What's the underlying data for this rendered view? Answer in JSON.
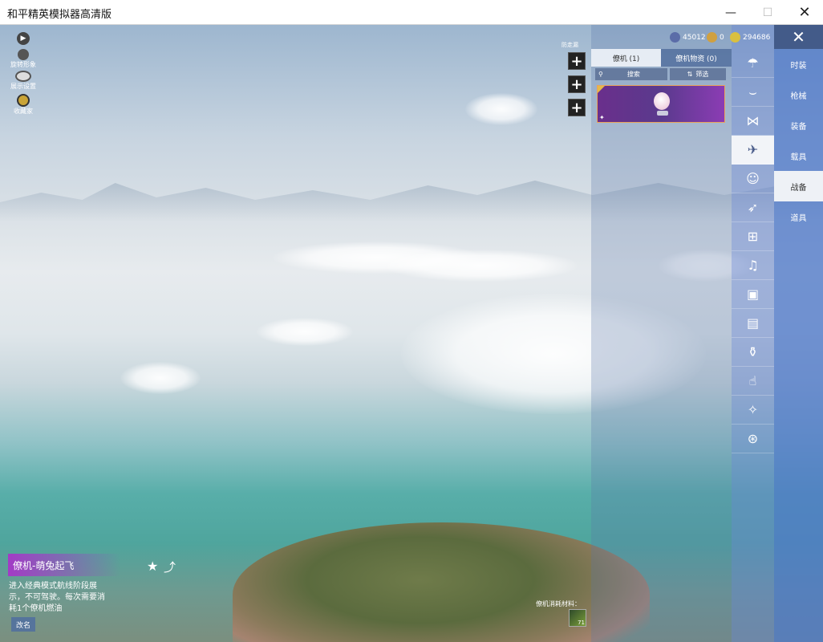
{
  "window": {
    "title": "和平精英模拟器高清版",
    "min_glyph": "—",
    "max_glyph": "☐",
    "close_glyph": "✕"
  },
  "left_tools": [
    {
      "label": "",
      "icon": "play-icon"
    },
    {
      "label": "旋转形象",
      "icon": "person-icon"
    },
    {
      "label": "展示设置",
      "icon": "eye-icon"
    },
    {
      "label": "收藏家",
      "icon": "collector-badge-icon"
    }
  ],
  "hud": {
    "top_small_text": "防走漏",
    "currency": [
      {
        "icon": "gem-icon",
        "value": "45012",
        "color": "#5b6ca8"
      },
      {
        "icon": "medal-icon",
        "value": "0",
        "color": "#d0a040"
      },
      {
        "icon": "coupon-icon",
        "value": "294686",
        "color": "#d9c040"
      }
    ],
    "close_glyph": "✕"
  },
  "plus_buttons": [
    "+",
    "+",
    "+"
  ],
  "panel": {
    "tabs": [
      {
        "label": "僚机 (1)",
        "active": true
      },
      {
        "label": "僚机物资 (0)",
        "active": false
      }
    ],
    "search_label": "搜索",
    "filter_label": "筛选",
    "card": {
      "name": "萌兔起飞",
      "corner_glyph": "✦"
    }
  },
  "icon_column": [
    {
      "icon": "parachute-icon",
      "active": false
    },
    {
      "icon": "glider-icon",
      "active": false
    },
    {
      "icon": "drone-icon",
      "active": false
    },
    {
      "icon": "plane-icon",
      "active": true
    },
    {
      "icon": "emote-icon",
      "active": false
    },
    {
      "icon": "jet-icon",
      "active": false
    },
    {
      "icon": "robot-icon",
      "active": false
    },
    {
      "icon": "sound-icon",
      "active": false
    },
    {
      "icon": "frame-icon",
      "active": false
    },
    {
      "icon": "image-icon",
      "active": false
    },
    {
      "icon": "spray-icon",
      "active": false
    },
    {
      "icon": "gesture-icon",
      "active": false
    },
    {
      "icon": "wand-icon",
      "active": false
    },
    {
      "icon": "ufo-icon",
      "active": false
    }
  ],
  "main_tabs": [
    {
      "label": "时装",
      "active": false
    },
    {
      "label": "枪械",
      "active": false
    },
    {
      "label": "装备",
      "active": false
    },
    {
      "label": "载具",
      "active": false
    },
    {
      "label": "战备",
      "active": true
    },
    {
      "label": "道具",
      "active": false
    }
  ],
  "info": {
    "title": "僚机-萌兔起飞",
    "description": "进入经典模式航线阶段展示，不可驾驶。每次需要消耗1个僚机燃油",
    "rename_label": "改名",
    "favorite_glyph": "★",
    "share_glyph": "⤴"
  },
  "material": {
    "label": "僚机消耗材料：",
    "count": "71"
  }
}
